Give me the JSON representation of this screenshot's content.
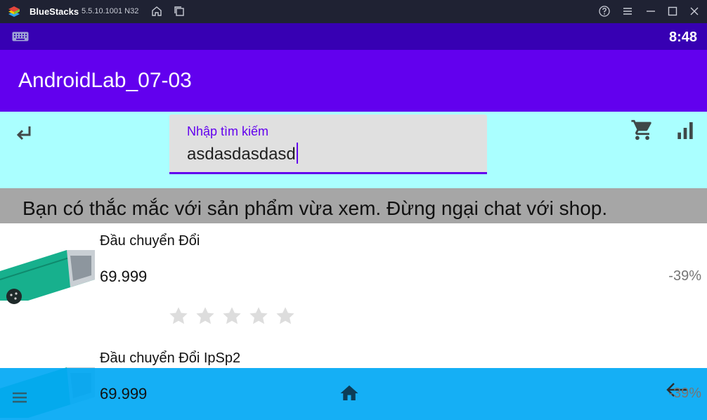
{
  "emulator": {
    "app_name": "BlueStacks",
    "version": "5.5.10.1001 N32",
    "icons": [
      "bluestacks-logo-icon",
      "home-icon",
      "multi-window-icon",
      "help-icon",
      "menu-icon",
      "minimize-icon",
      "maximize-icon",
      "close-icon"
    ]
  },
  "status_bar": {
    "time": "8:48",
    "icons": [
      "keyboard-icon"
    ]
  },
  "app_bar": {
    "title": "AndroidLab_07-03"
  },
  "toolbar": {
    "search_label": "Nhập tìm kiếm",
    "search_value": "asdasdasdasd",
    "icons": [
      "return-icon",
      "cart-icon",
      "bar-chart-icon"
    ]
  },
  "banner": {
    "text": "Bạn có thắc mắc với sản phẩm vừa xem. Đừng ngại chat với shop."
  },
  "products": [
    {
      "name": "Đầu chuyển Đổi",
      "price": "69.999",
      "discount": "-39%",
      "rating": 0,
      "max_rating": 5,
      "image": "usb-ps2-adapter"
    },
    {
      "name": "Đầu chuyển Đổi IpSp2",
      "price": "69.999",
      "discount": "-39%",
      "image": "usb-ps2-adapter"
    }
  ],
  "bottom_nav": {
    "icons": [
      "menu-icon",
      "home-icon",
      "back-arrow-icon"
    ]
  },
  "colors": {
    "status_bar": "#3700b3",
    "app_bar": "#6200ee",
    "toolbar": "#aaffff",
    "banner": "#a6a6a6",
    "bottom_nav": "#03a9f4",
    "accent": "#6200ee"
  }
}
